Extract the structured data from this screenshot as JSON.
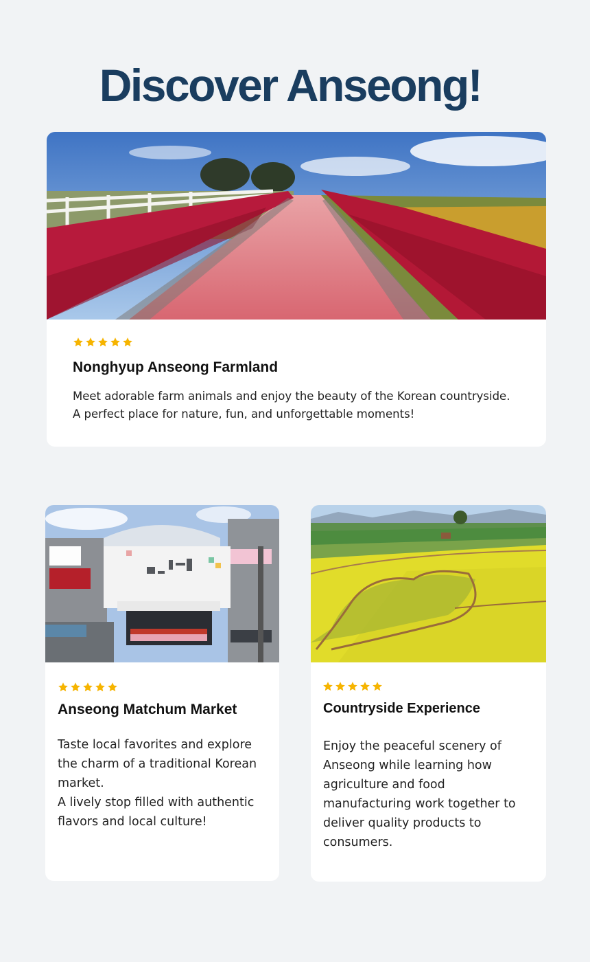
{
  "page": {
    "title": "Discover Anseong!",
    "title_color": "#1a3d5f",
    "background_color": "#f1f3f5"
  },
  "colors": {
    "star": "#f6b400",
    "card_background": "#ffffff"
  },
  "cards": [
    {
      "image": "photo of a pink walkway lined with red kochia bushes and a flower field",
      "rating": 5,
      "title": "Nonghyup Anseong Farmland",
      "description": "Meet adorable farm animals and enjoy the beauty of the Korean countryside.\n A perfect place for nature, fun, and unforgettable moments!"
    },
    {
      "image": "photo of the Anseong Matchum Market building entrance",
      "rating": 5,
      "title": "Anseong Matchum Market",
      "description": "Taste local favorites and explore the charm of a traditional Korean market.\n A lively stop filled with authentic flavors and local culture!"
    },
    {
      "image": "photo of a yellow canola field with a heart-shaped path",
      "rating": 5,
      "title": "Countryside Experience",
      "description": "Enjoy the peaceful scenery of Anseong while learning how agriculture and food manufacturing work together to deliver quality products to consumers."
    }
  ]
}
